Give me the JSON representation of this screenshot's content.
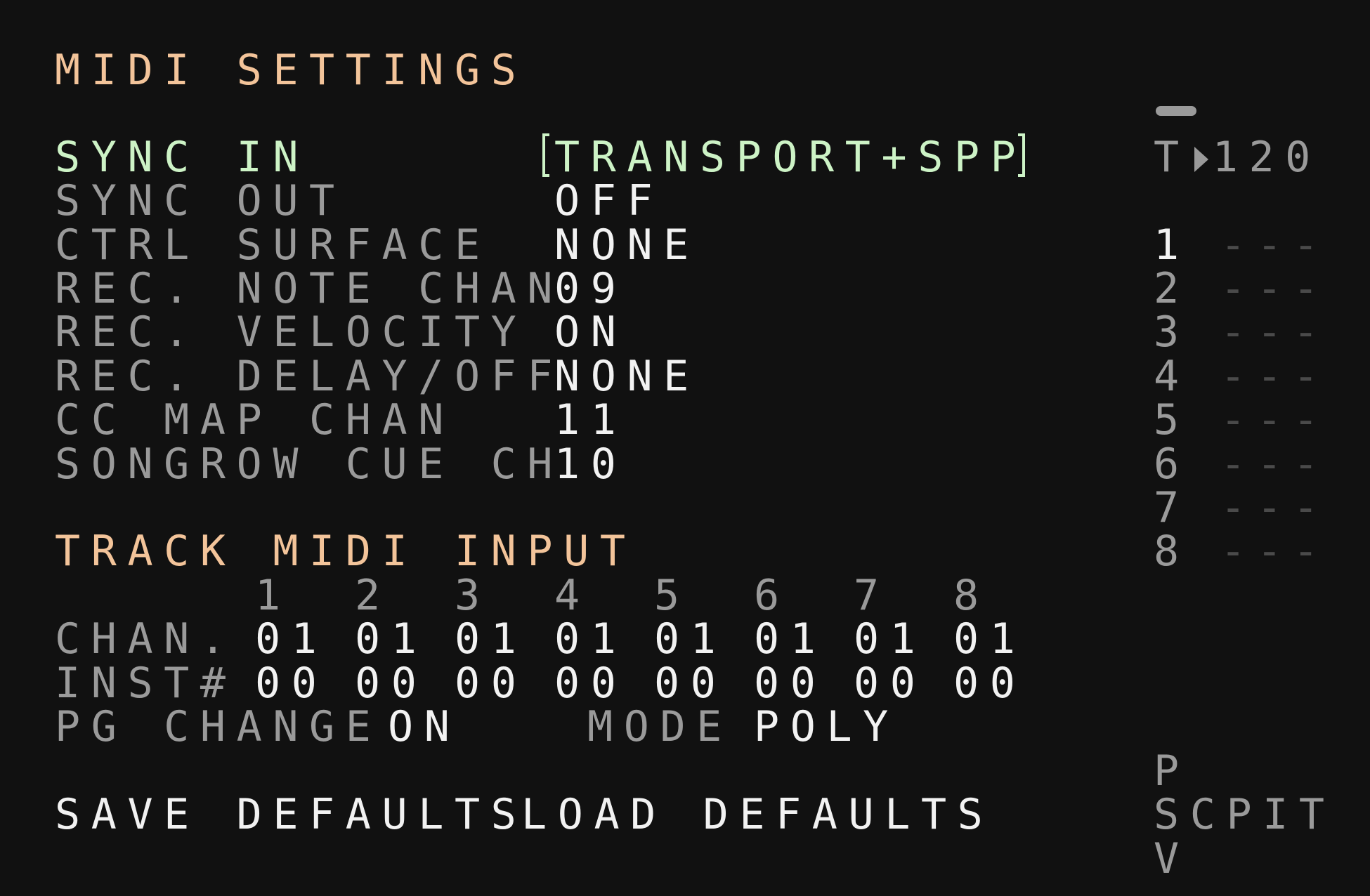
{
  "midi_settings": {
    "title": "MIDI SETTINGS",
    "rows": [
      {
        "label": "SYNC IN",
        "value": "TRANSPORT+SPP"
      },
      {
        "label": "SYNC OUT",
        "value": "OFF"
      },
      {
        "label": "CTRL SURFACE",
        "value": "NONE"
      },
      {
        "label": "REC. NOTE CHAN",
        "value": "09"
      },
      {
        "label": "REC. VELOCITY",
        "value": "ON"
      },
      {
        "label": "REC. DELAY/OFF",
        "value": "NONE"
      },
      {
        "label": "CC MAP CHAN",
        "value": "11"
      },
      {
        "label": "SONGROW CUE CH",
        "value": "10"
      }
    ]
  },
  "track_midi_input": {
    "title": "TRACK MIDI INPUT",
    "tracks": [
      "1",
      "2",
      "3",
      "4",
      "5",
      "6",
      "7",
      "8"
    ],
    "chan_label": "CHAN.",
    "chan_values": [
      "01",
      "01",
      "01",
      "01",
      "01",
      "01",
      "01",
      "01"
    ],
    "inst_label": "INST#",
    "inst_values": [
      "00",
      "00",
      "00",
      "00",
      "00",
      "00",
      "00",
      "00"
    ],
    "pg_change_label": "PG CHANGE",
    "pg_change_value": "ON",
    "mode_label": "MODE",
    "mode_value": "POLY"
  },
  "actions": {
    "save_defaults": "SAVE DEFAULTS",
    "load_defaults": "LOAD DEFAULTS"
  },
  "side_panel": {
    "tempo_prefix": "T",
    "tempo_value": "120",
    "tracks": [
      {
        "num": "1",
        "dash": "---"
      },
      {
        "num": "2",
        "dash": "---"
      },
      {
        "num": "3",
        "dash": "---"
      },
      {
        "num": "4",
        "dash": "---"
      },
      {
        "num": "5",
        "dash": "---"
      },
      {
        "num": "6",
        "dash": "---"
      },
      {
        "num": "7",
        "dash": "---"
      },
      {
        "num": "8",
        "dash": "---"
      }
    ],
    "nav_top": "P",
    "nav_middle": "SCPIT",
    "nav_bottom": "V"
  },
  "colors": {
    "background": "#111111",
    "heading": "#f3c49a",
    "selected": "#cdf3c6",
    "label": "#9a9a9a",
    "value": "#f2f2f2"
  }
}
